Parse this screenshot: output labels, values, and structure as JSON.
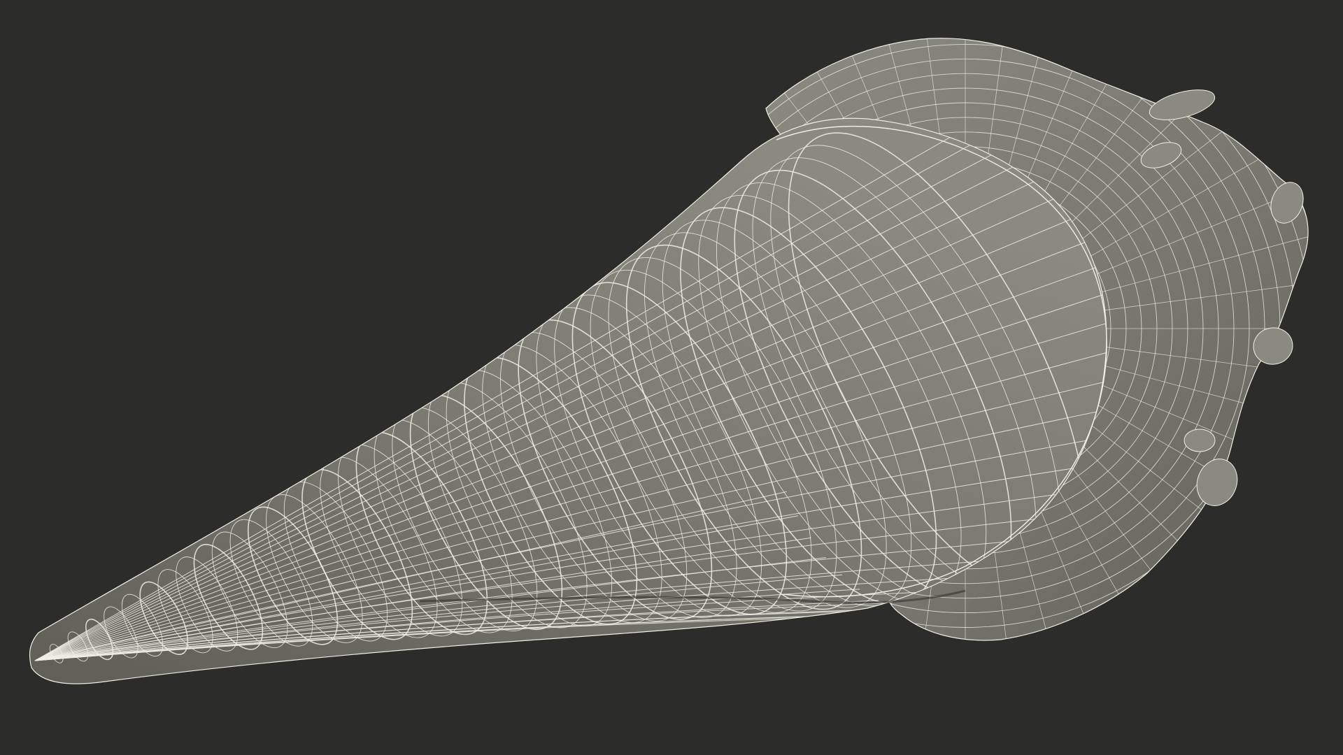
{
  "scene": {
    "subject_icon": "wireframe-cone-icon",
    "colors": {
      "background": "#2c2c2b",
      "surface": "#7b7b72",
      "surface_light": "#8a8a80",
      "surface_dark": "#5f5f58",
      "wire": "#f1efe4"
    },
    "display_mode": "wireframe-on-shaded"
  }
}
